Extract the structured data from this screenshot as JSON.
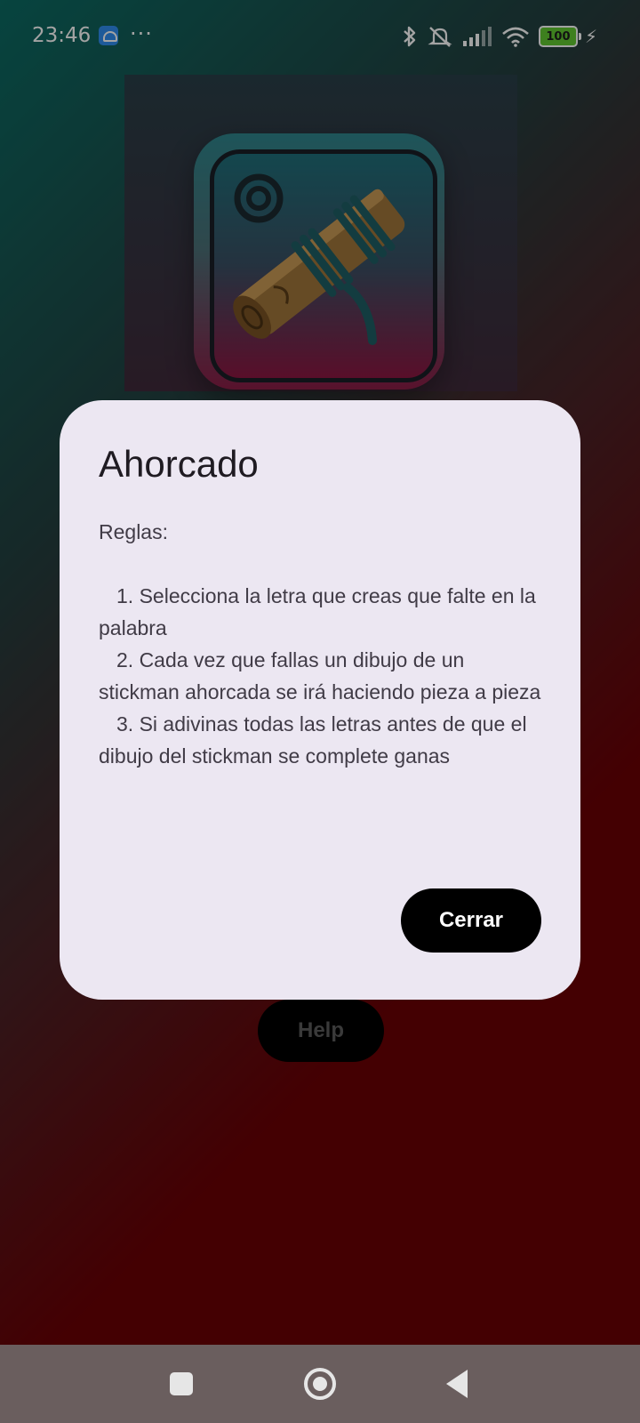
{
  "status_bar": {
    "time": "23:46",
    "more": "···",
    "battery": "100",
    "icons": [
      "bluetooth-icon",
      "muted-vibrate-icon",
      "signal-icon",
      "wifi-icon",
      "battery-icon",
      "charging-icon"
    ]
  },
  "main": {
    "help_label": "Help"
  },
  "dialog": {
    "title": "Ahorcado",
    "rules_label": "Reglas:",
    "rules": [
      "1. Selecciona la letra que creas que falte en la palabra",
      "2. Cada vez que fallas un dibujo de un stickman ahorcada se irá haciendo pieza a pieza",
      "3. Si adivinas todas las letras antes de que el dibujo del stickman se complete ganas"
    ],
    "close_label": "Cerrar"
  },
  "nav_bar": {
    "icons": [
      "recent-apps-icon",
      "home-icon",
      "back-icon"
    ]
  }
}
